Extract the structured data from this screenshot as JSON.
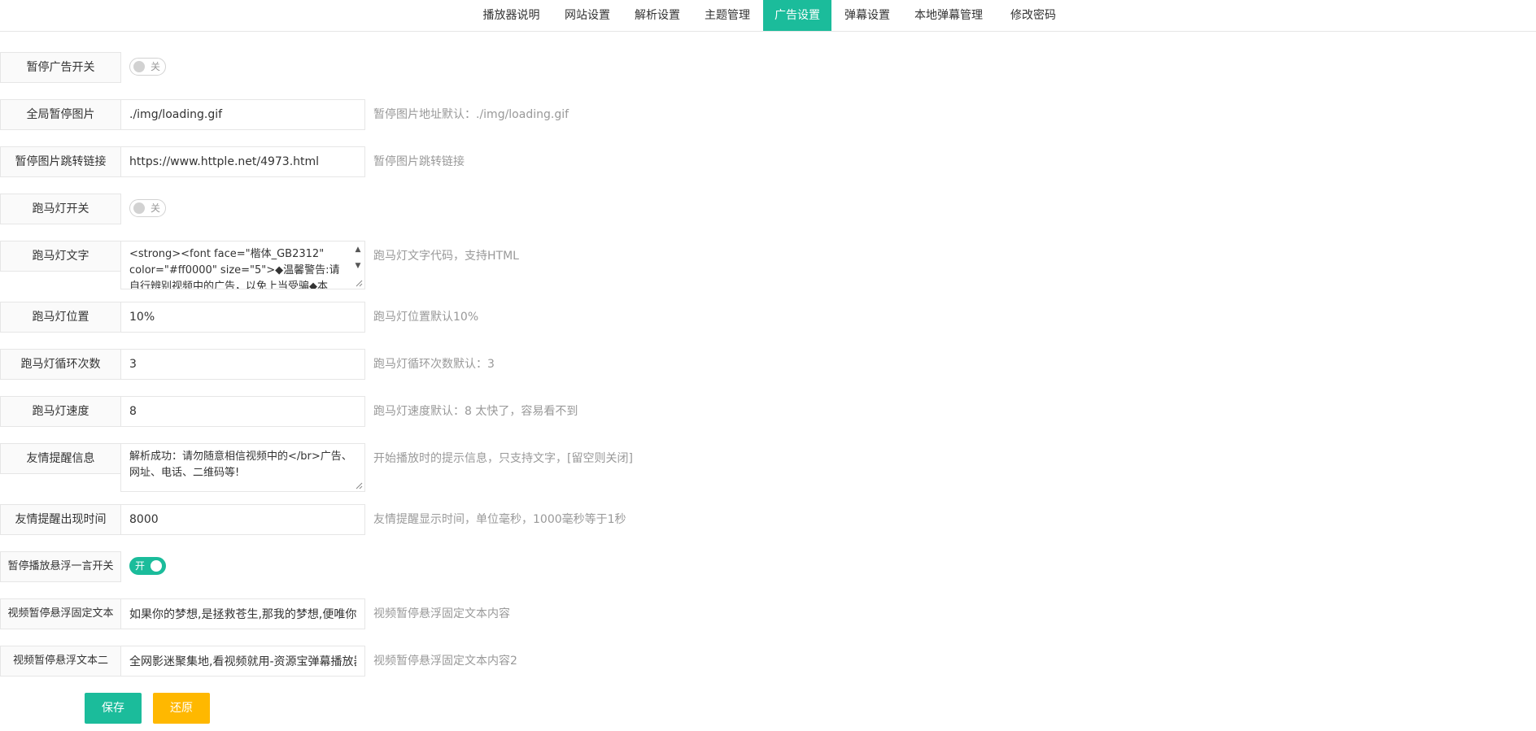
{
  "nav": {
    "tabs": [
      {
        "label": "播放器说明"
      },
      {
        "label": "网站设置"
      },
      {
        "label": "解析设置"
      },
      {
        "label": "主题管理"
      },
      {
        "label": "广告设置"
      },
      {
        "label": "弹幕设置"
      },
      {
        "label": "本地弹幕管理"
      },
      {
        "label": "修改密码"
      }
    ],
    "active_tab": "广告设置"
  },
  "form": {
    "pause_ad_switch": {
      "label": "暂停广告开关",
      "state": "关"
    },
    "global_pause_image": {
      "label": "全局暂停图片",
      "value": "./img/loading.gif",
      "hint": "暂停图片地址默认：./img/loading.gif"
    },
    "pause_image_link": {
      "label": "暂停图片跳转链接",
      "value": "https://www.httple.net/4973.html",
      "hint": "暂停图片跳转链接"
    },
    "marquee_switch": {
      "label": "跑马灯开关",
      "state": "关"
    },
    "marquee_text": {
      "label": "跑马灯文字",
      "value": "<strong><font face=\"楷体_GB2312\" color=\"#ff0000\" size=\"5\">◆温馨警告:请自行辨别视频中的广告，以免上当受骗◆本",
      "hint": "跑马灯文字代码，支持HTML"
    },
    "marquee_position": {
      "label": "跑马灯位置",
      "value": "10%",
      "hint": "跑马灯位置默认10%"
    },
    "marquee_loops": {
      "label": "跑马灯循环次数",
      "value": "3",
      "hint": "跑马灯循环次数默认：3"
    },
    "marquee_speed": {
      "label": "跑马灯速度",
      "value": "8",
      "hint": "跑马灯速度默认：8 太快了，容易看不到"
    },
    "friendly_notice": {
      "label": "友情提醒信息",
      "value": "解析成功：请勿随意相信视频中的</br>广告、网址、电话、二维码等!",
      "hint": "开始播放时的提示信息，只支持文字，[留空则关闭]"
    },
    "notice_duration": {
      "label": "友情提醒出现时间",
      "value": "8000",
      "hint": "友情提醒显示时间，单位毫秒，1000毫秒等于1秒"
    },
    "pause_quote_switch": {
      "label": "暂停播放悬浮一言开关",
      "state": "开"
    },
    "pause_fixed_text": {
      "label": "视频暂停悬浮固定文本",
      "value": "如果你的梦想,是拯救苍生,那我的梦想,便唯你一人",
      "hint": "视频暂停悬浮固定文本内容"
    },
    "pause_fixed_text2": {
      "label": "视频暂停悬浮文本二",
      "value": "全网影迷聚集地,看视频就用-资源宝弹幕播放器",
      "hint": "视频暂停悬浮固定文本内容2"
    }
  },
  "buttons": {
    "save": "保存",
    "reset": "还原"
  },
  "colors": {
    "accent": "#1bbc9b",
    "warn": "#ffb800"
  }
}
